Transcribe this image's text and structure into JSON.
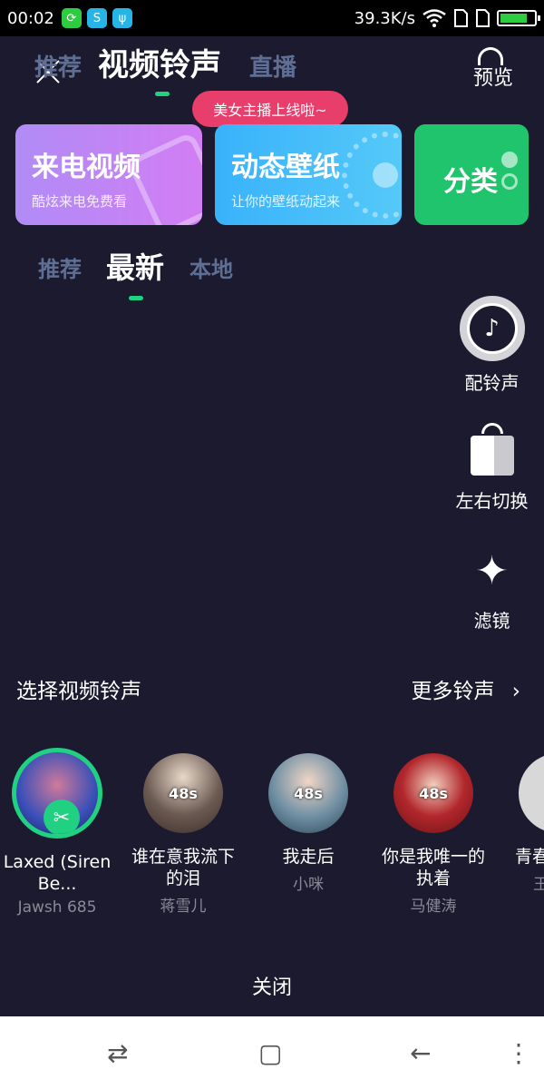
{
  "status_bar": {
    "time": "00:02",
    "speed": "39.3K/s",
    "app_icons": [
      {
        "name": "app-icon-1",
        "color": "#2ecc40",
        "glyph": "⟳"
      },
      {
        "name": "app-icon-2",
        "color": "#27b5e8",
        "glyph": "S"
      },
      {
        "name": "usb-icon",
        "color": "#27b5e8",
        "glyph": "ψ"
      }
    ],
    "battery_level": 0.8
  },
  "top_nav": {
    "tabs": [
      "推荐",
      "视频铃声",
      "直播"
    ],
    "active_tab": "视频铃声",
    "preview_label": "预览",
    "live_badge": "美女主播上线啦~"
  },
  "feature_cards": [
    {
      "title": "来电视频",
      "subtitle": "酷炫来电免费看"
    },
    {
      "title": "动态壁纸",
      "subtitle": "让你的壁纸动起来"
    },
    {
      "title": "分类",
      "subtitle": ""
    }
  ],
  "sub_tabs": {
    "tabs": [
      "推荐",
      "最新",
      "本地"
    ],
    "active_tab": "最新"
  },
  "tools": [
    {
      "label": "配铃声",
      "icon": "music-note-icon"
    },
    {
      "label": "左右切换",
      "icon": "switch-icon"
    },
    {
      "label": "滤镜",
      "icon": "magic-wand-icon"
    }
  ],
  "select_section": {
    "title": "选择视频铃声",
    "more_label": "更多铃声",
    "more_arrow": "›"
  },
  "ringtones": [
    {
      "title": "Laxed (Siren Be...",
      "artist": "Jawsh 685",
      "duration": "",
      "selected": true,
      "color": "#3a4fb8"
    },
    {
      "title": "谁在意我流下的泪",
      "artist": "蒋雪儿",
      "duration": "48s",
      "selected": false,
      "color": "#6b5a52"
    },
    {
      "title": "我走后",
      "artist": "小咪",
      "duration": "48s",
      "selected": false,
      "color": "#6f8fa3"
    },
    {
      "title": "你是我唯一的执着",
      "artist": "马健涛",
      "duration": "48s",
      "selected": false,
      "color": "#b2272c"
    },
    {
      "title": "青春",
      "artist": "王",
      "duration": "",
      "selected": false,
      "color": "#d8d8d8"
    }
  ],
  "close_label": "关闭",
  "nav_bar": {
    "recent_glyph": "⇄",
    "home_glyph": "▢",
    "back_glyph": "←",
    "menu_glyph": "⋮"
  },
  "colors": {
    "background": "#1b1a2e",
    "accent": "#1fd181",
    "badge": "#e83e6b",
    "dim_tab": "#5f6f94"
  }
}
